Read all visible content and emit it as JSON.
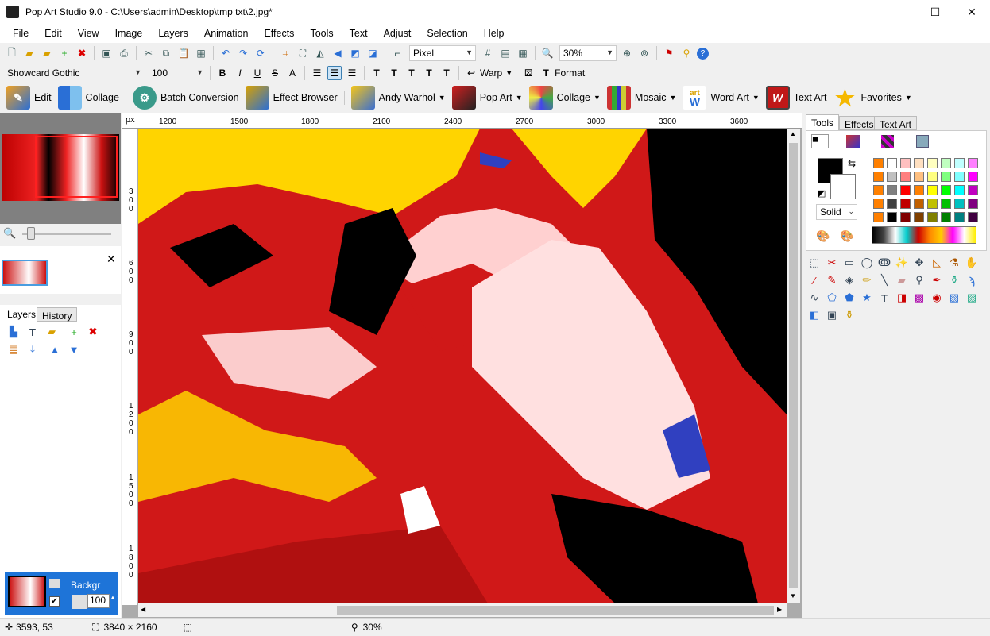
{
  "window": {
    "title": "Pop Art Studio 9.0 - C:\\Users\\admin\\Desktop\\tmp txt\\2.jpg*"
  },
  "menu": [
    "File",
    "Edit",
    "View",
    "Image",
    "Layers",
    "Animation",
    "Effects",
    "Tools",
    "Text",
    "Adjust",
    "Selection",
    "Help"
  ],
  "toolbar1": {
    "unit": "Pixel",
    "zoom": "30%"
  },
  "toolbar2": {
    "font": "Showcard Gothic",
    "size": "100",
    "warp": "Warp",
    "format": "Format"
  },
  "toolbar3": {
    "edit": "Edit",
    "collage1": "Collage",
    "batch": "Batch Conversion",
    "browser": "Effect Browser",
    "warhol": "Andy Warhol",
    "popart": "Pop Art",
    "collage2": "Collage",
    "mosaic": "Mosaic",
    "wordart": "Word Art",
    "textart": "Text Art",
    "favorites": "Favorites",
    "wordart_icon_top": "art",
    "wordart_icon_side": "word",
    "wordart_icon_w": "W"
  },
  "ruler": {
    "unit": "px",
    "hticks": [
      "1200",
      "1500",
      "1800",
      "2100",
      "2400",
      "2700",
      "3000",
      "3300",
      "3600"
    ],
    "vticks": [
      "300",
      "600",
      "900",
      "1200",
      "1500",
      "1800"
    ]
  },
  "layers": {
    "tabs": [
      "Layers",
      "History"
    ],
    "layer_name": "Backgr",
    "opacity": "100"
  },
  "right": {
    "tabs": [
      "Tools",
      "Effects",
      "Text Art"
    ],
    "fill_mode": "Solid"
  },
  "palette": [
    "#ff8000",
    "#ffffff",
    "#ffc0c0",
    "#ffe0c0",
    "#ffffc0",
    "#c0ffc0",
    "#c0ffff",
    "#ff80ff",
    "#ff8000",
    "#c0c0c0",
    "#ff8080",
    "#ffc080",
    "#ffff80",
    "#80ff80",
    "#80ffff",
    "#ff00ff",
    "#ff8000",
    "#808080",
    "#ff0000",
    "#ff8000",
    "#ffff00",
    "#00ff00",
    "#00ffff",
    "#c000c0",
    "#ff8000",
    "#404040",
    "#c00000",
    "#c06000",
    "#c0c000",
    "#00c000",
    "#00c0c0",
    "#800080",
    "#ff8000",
    "#000000",
    "#800000",
    "#804000",
    "#808000",
    "#008000",
    "#008080",
    "#400040"
  ],
  "status": {
    "coords": "3593, 53",
    "size": "3840 × 2160",
    "zoom": "30%"
  }
}
